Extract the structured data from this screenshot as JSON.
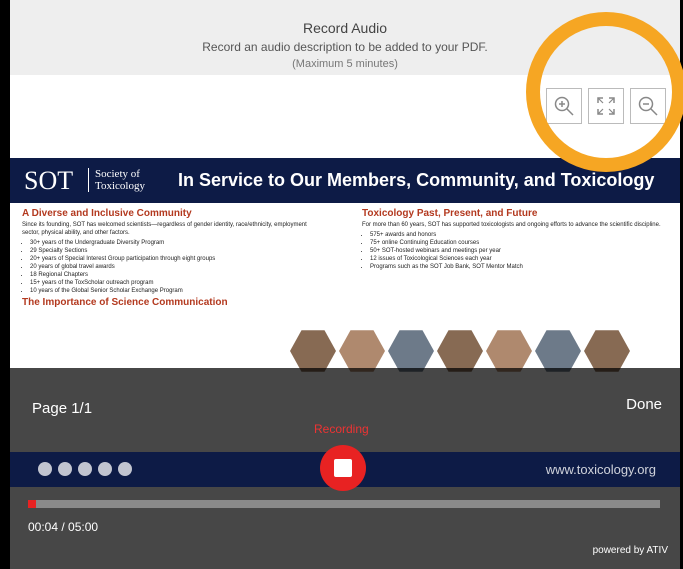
{
  "header": {
    "title": "Record Audio",
    "subtitle": "Record an audio description to be added to your PDF.",
    "limit": "(Maximum 5 minutes)"
  },
  "zoom": {
    "icons": [
      "zoom-in-icon",
      "fit-screen-icon",
      "zoom-out-icon"
    ]
  },
  "pdf": {
    "logo": "SOT",
    "logo_sub1": "Society of",
    "logo_sub2": "Toxicology",
    "tagline": "In Service to Our Members, Community, and Toxicology",
    "left_heading": "A Diverse and Inclusive Community",
    "left_intro": "Since its founding, SOT has welcomed scientists—regardless of gender identity, race/ethnicity, employment sector, physical ability, and other factors.",
    "left_items": [
      "30+ years of the Undergraduate Diversity Program",
      "29 Specialty Sections",
      "20+ years of Special Interest Group participation through eight groups",
      "20 years of global travel awards",
      "18 Regional Chapters",
      "15+ years of the ToxScholar outreach program",
      "10 years of the Global Senior Scholar Exchange Program"
    ],
    "left_heading2": "The Importance of Science Communication",
    "right_heading": "Toxicology Past, Present, and Future",
    "right_intro": "For more than 60 years, SOT has supported toxicologists and ongoing efforts to advance the scientific discipline.",
    "right_items": [
      "575+ awards and honors",
      "75+ online Continuing Education courses",
      "50+ SOT-hosted webinars and meetings per year",
      "12 issues of Toxicological Sciences each year",
      "Programs such as the SOT Job Bank, SOT Mentor Match"
    ],
    "website": "www.toxicology.org"
  },
  "controls": {
    "page_label": "Page 1/1",
    "done_label": "Done",
    "recording_label": "Recording",
    "time": "00:04 / 05:00",
    "progress_fraction": 0.013,
    "powered": "powered by ATIV"
  },
  "colors": {
    "accent_circle": "#f6a623",
    "record": "#e82222",
    "navy": "#0d1b46"
  }
}
